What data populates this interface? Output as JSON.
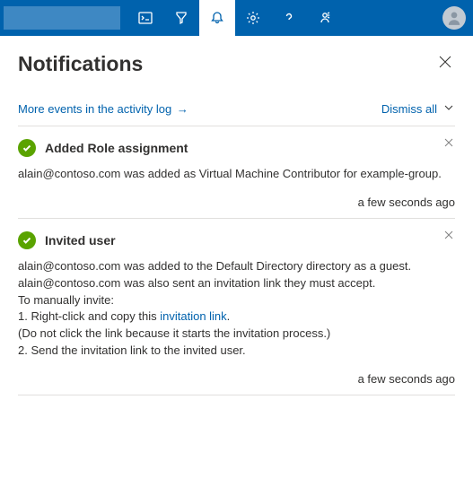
{
  "topbar": {
    "icons": {
      "cloudshell": "cloud-shell-icon",
      "directory": "directory-filter-icon",
      "notifications": "bell-icon",
      "settings": "gear-icon",
      "help": "help-icon",
      "feedback": "feedback-icon"
    }
  },
  "panel": {
    "title": "Notifications",
    "more_events": "More events in the activity log",
    "dismiss_all": "Dismiss all"
  },
  "notifications": [
    {
      "title": "Added Role assignment",
      "body": "alain@contoso.com was added as Virtual Machine Contributor for example-group.",
      "time": "a few seconds ago",
      "status": "success"
    },
    {
      "title": "Invited user",
      "body_lines": [
        "alain@contoso.com was added to the Default Directory directory as a guest.",
        "alain@contoso.com was also sent an invitation link they must accept.",
        "To manually invite:",
        "1. Right-click and copy this ",
        ".",
        "(Do not click the link because it starts the invitation process.)",
        "2. Send the invitation link to the invited user."
      ],
      "link_text": "invitation link",
      "time": "a few seconds ago",
      "status": "success"
    }
  ]
}
